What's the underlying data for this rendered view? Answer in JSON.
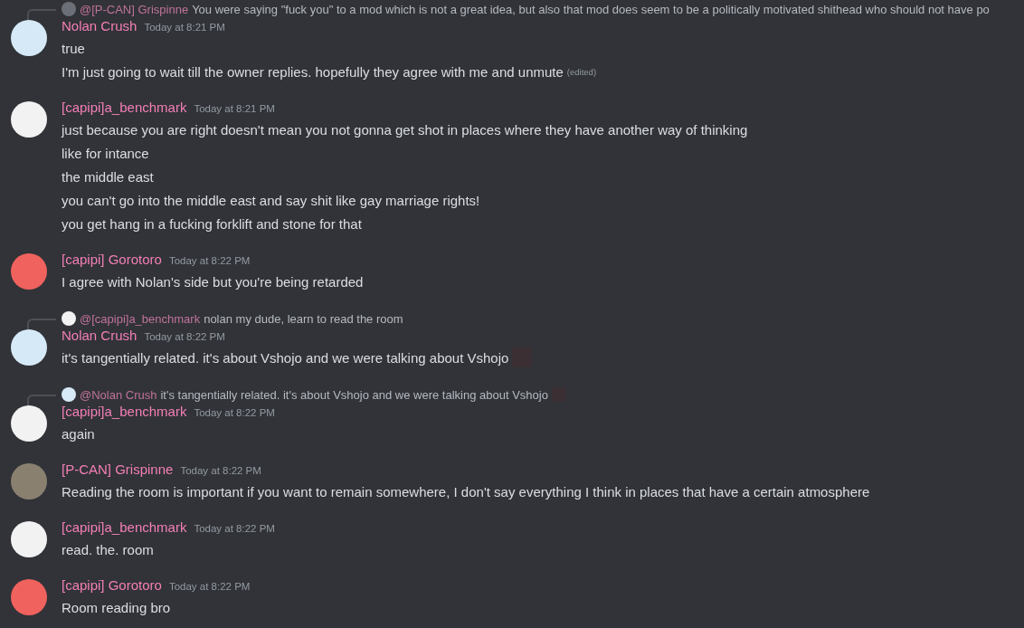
{
  "messages": [
    {
      "reply": {
        "author": "@[P-CAN] Grispinne",
        "text": "You were saying \"fuck you\" to a mod which is not a great idea, but also that mod does seem to be a politically motivated shithead who should not have po",
        "color": "#6b6f78"
      },
      "author": "Nolan Crush",
      "timestamp": "Today at 8:21 PM",
      "color": "#d6e9f7",
      "lines": [
        {
          "text": "true"
        },
        {
          "text": "I'm just going to wait till the owner replies. hopefully they agree with me and unmute",
          "edited": "(edited)"
        }
      ]
    },
    {
      "author": "[capipi]a_benchmark",
      "timestamp": "Today at 8:21 PM",
      "color": "#f2f2f2",
      "lines": [
        {
          "text": "just because you are right doesn't mean you not gonna get shot in places where they have another way of thinking"
        },
        {
          "text": "like for intance"
        },
        {
          "text": "the middle east"
        },
        {
          "text": "you can't go into the middle east and say shit like gay marriage rights!"
        },
        {
          "text": "you get hang in a fucking forklift and stone for that"
        }
      ]
    },
    {
      "author": "[capipi] Gorotoro",
      "timestamp": "Today at 8:22 PM",
      "color": "#f0625e",
      "lines": [
        {
          "text": "I agree with Nolan's side but you're being retarded"
        }
      ]
    },
    {
      "reply": {
        "author": "@[capipi]a_benchmark",
        "text": "nolan my dude, learn to read the room",
        "color": "#f2f2f2"
      },
      "author": "Nolan Crush",
      "timestamp": "Today at 8:22 PM",
      "color": "#d6e9f7",
      "lines": [
        {
          "text": "it's tangentially related. it's about Vshojo and we were talking about Vshojo",
          "emoji": true
        }
      ]
    },
    {
      "reply": {
        "author": "@Nolan Crush",
        "text": "it's tangentially related. it's about Vshojo and we were talking about Vshojo",
        "color": "#d6e9f7",
        "emoji": true
      },
      "author": "[capipi]a_benchmark",
      "timestamp": "Today at 8:22 PM",
      "color": "#f2f2f2",
      "lines": [
        {
          "text": "again"
        }
      ]
    },
    {
      "author": "[P-CAN] Grispinne",
      "timestamp": "Today at 8:22 PM",
      "color": "#8a8070",
      "lines": [
        {
          "text": "Reading the room is important if you want to remain somewhere, I don't say everything I think in places that have a certain atmosphere"
        }
      ]
    },
    {
      "author": "[capipi]a_benchmark",
      "timestamp": "Today at 8:22 PM",
      "color": "#f2f2f2",
      "lines": [
        {
          "text": "read. the. room"
        }
      ]
    },
    {
      "author": "[capipi] Gorotoro",
      "timestamp": "Today at 8:22 PM",
      "color": "#f0625e",
      "lines": [
        {
          "text": "Room reading bro"
        }
      ]
    }
  ]
}
